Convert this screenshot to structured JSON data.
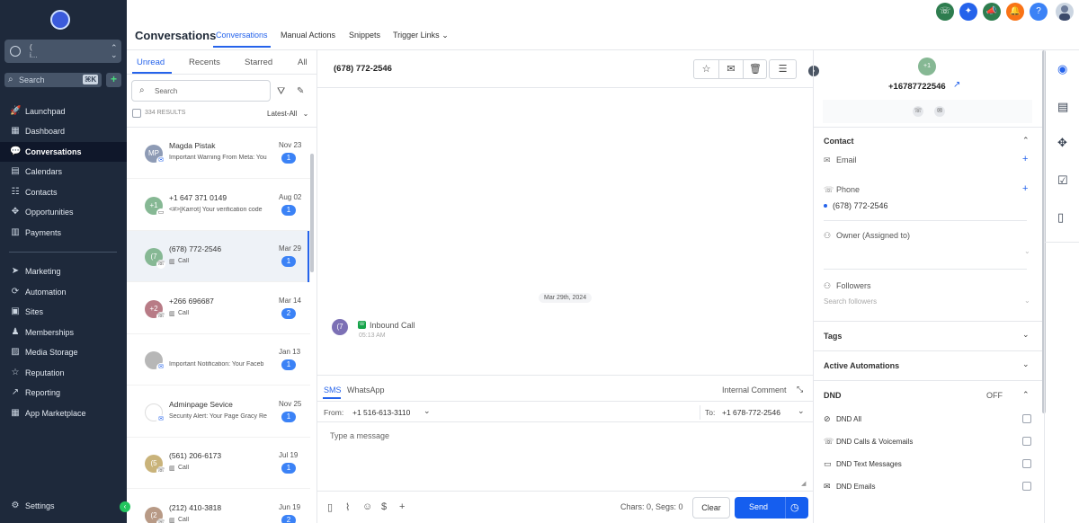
{
  "sidebar": {
    "account": {
      "line1": "(",
      "line2": "i..."
    },
    "search_placeholder": "Search",
    "search_kbd": "⌘K",
    "items": [
      {
        "label": "Launchpad",
        "icon": "rocket-icon",
        "glyph": "🚀"
      },
      {
        "label": "Dashboard",
        "icon": "dashboard-icon",
        "glyph": "▦"
      },
      {
        "label": "Conversations",
        "icon": "chat-icon",
        "glyph": "💬"
      },
      {
        "label": "Calendars",
        "icon": "calendar-icon",
        "glyph": "▤"
      },
      {
        "label": "Contacts",
        "icon": "contacts-icon",
        "glyph": "☷"
      },
      {
        "label": "Opportunities",
        "icon": "opportunities-icon",
        "glyph": "✥"
      },
      {
        "label": "Payments",
        "icon": "payments-icon",
        "glyph": "▥"
      },
      {
        "label": "Marketing",
        "icon": "send-icon",
        "glyph": "➤"
      },
      {
        "label": "Automation",
        "icon": "automation-icon",
        "glyph": "⟳"
      },
      {
        "label": "Sites",
        "icon": "sites-icon",
        "glyph": "▣"
      },
      {
        "label": "Memberships",
        "icon": "memberships-icon",
        "glyph": "♟"
      },
      {
        "label": "Media Storage",
        "icon": "media-icon",
        "glyph": "▨"
      },
      {
        "label": "Reputation",
        "icon": "star-icon",
        "glyph": "☆"
      },
      {
        "label": "Reporting",
        "icon": "trend-icon",
        "glyph": "↗"
      },
      {
        "label": "App Marketplace",
        "icon": "apps-icon",
        "glyph": "▦"
      }
    ],
    "settings_label": "Settings"
  },
  "header": {
    "title": "Conversations",
    "tabs": [
      "Conversations",
      "Manual Actions",
      "Snippets",
      "Trigger Links"
    ],
    "trigger_chevron": "⌄"
  },
  "top_icons": [
    {
      "name": "phone-icon",
      "glyph": "☏",
      "color": "#2e7d4f"
    },
    {
      "name": "magic-icon",
      "glyph": "✦",
      "color": "#2563eb"
    },
    {
      "name": "megaphone-icon",
      "glyph": "📣",
      "color": "#2e7d4f"
    },
    {
      "name": "bell-icon",
      "glyph": "🔔",
      "color": "#f97316"
    },
    {
      "name": "help-icon",
      "glyph": "?",
      "color": "#3b82f6"
    }
  ],
  "list": {
    "filters": [
      "Unread",
      "Recents",
      "Starred",
      "All"
    ],
    "search_placeholder": "Search",
    "results": "334 RESULTS",
    "sort": "Latest-All",
    "conversations": [
      {
        "initials": "MP",
        "avatar_color": "#8e9bb5",
        "name": "Magda Pistak",
        "preview": "Important Warning From Meta: You",
        "date": "Nov 23",
        "count": "1",
        "channel": "messenger"
      },
      {
        "initials": "+1",
        "avatar_color": "#86b894",
        "name": "+1 647 371 0149",
        "preview": "<#>[Karrot] Your verification code",
        "date": "Aug 02",
        "count": "1",
        "channel": "sms"
      },
      {
        "initials": "(7",
        "avatar_color": "#86b894",
        "name": "(678) 772-2546",
        "preview": "Call",
        "date": "Mar 29",
        "count": "1",
        "channel": "call"
      },
      {
        "initials": "+2",
        "avatar_color": "#b87b86",
        "name": "+266 696687",
        "preview": "Call",
        "date": "Mar 14",
        "count": "2",
        "channel": "call"
      },
      {
        "initials": "",
        "avatar_color": "#b7b7b7",
        "name": "",
        "preview": "Important Notification: Your Faceb",
        "date": "Jan 13",
        "count": "1",
        "channel": "messenger"
      },
      {
        "initials": "",
        "avatar_color": "#ffffff",
        "name": "Adminpage Sevice",
        "preview": "Security Alert: Your Page Gracy Re",
        "date": "Nov 25",
        "count": "1",
        "channel": "messenger"
      },
      {
        "initials": "(5",
        "avatar_color": "#c9b37a",
        "name": "(561) 206-6173",
        "preview": "Call",
        "date": "Jul 19",
        "count": "1",
        "channel": "call"
      },
      {
        "initials": "(2",
        "avatar_color": "#b89a86",
        "name": "(212) 410-3818",
        "preview": "Call",
        "date": "Jun 19",
        "count": "2",
        "channel": "call"
      }
    ]
  },
  "chat": {
    "title": "(678) 772-2546",
    "date_chip": "Mar 29th, 2024",
    "message": {
      "avatar": "(7",
      "title": "Inbound Call",
      "time": "05:13 AM"
    },
    "composer": {
      "tabs": [
        "SMS",
        "WhatsApp"
      ],
      "internal": "Internal Comment",
      "from_label": "From:",
      "from_value": "+1 516-613-3110",
      "to_label": "To:",
      "to_value": "+1 678-772-2546",
      "placeholder": "Type a message",
      "chars": "Chars: 0, Segs: 0",
      "clear": "Clear",
      "send": "Send"
    }
  },
  "contact": {
    "avatar": "+1",
    "phone": "+16787722546",
    "sections": {
      "contact": "Contact",
      "email_label": "Email",
      "phone_label": "Phone",
      "phone_value": "(678) 772-2546",
      "owner_label": "Owner (Assigned to)",
      "followers_label": "Followers",
      "followers_placeholder": "Search followers",
      "tags": "Tags",
      "automations": "Active Automations",
      "dnd": "DND",
      "dnd_state": "OFF",
      "dnd_items": [
        "DND All",
        "DND Calls & Voicemails",
        "DND Text Messages",
        "DND Emails"
      ]
    }
  }
}
